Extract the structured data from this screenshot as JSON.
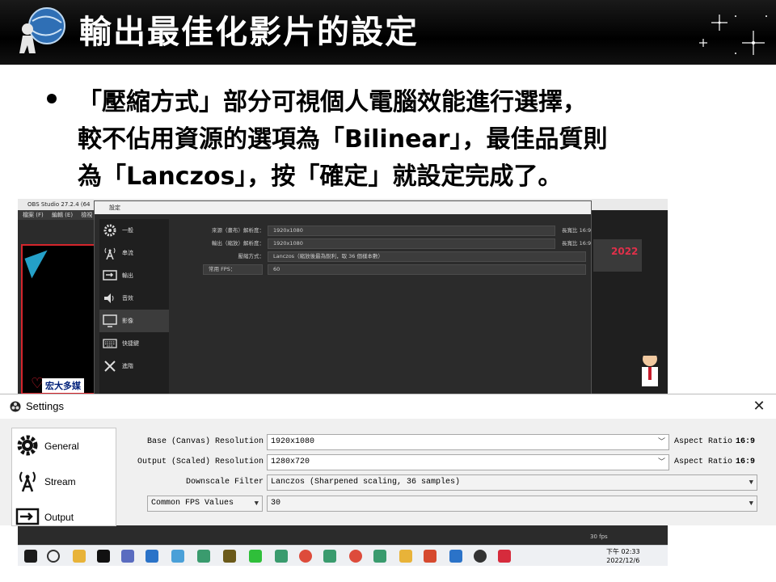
{
  "slide": {
    "title": "輸出最佳化影片的設定",
    "bullet_lines": [
      "「壓縮方式」部分可視個人電腦效能進行選擇，",
      "較不佔用資源的選項為「Bilinear」，最佳品質則",
      "為「Lanczos」，按「確定」就設定完成了。"
    ]
  },
  "obs_window": {
    "title": "OBS Studio 27.2.4 (64",
    "menu": [
      "檔案 (F)",
      "編輯 (E)",
      "檢視"
    ],
    "banner_text": "宏大多媒",
    "year_text": "2022",
    "fps_text": "30 fps",
    "dark_settings": {
      "title": "設定",
      "sidebar": [
        {
          "label": "一般",
          "icon": "gear-icon"
        },
        {
          "label": "串流",
          "icon": "antenna-icon"
        },
        {
          "label": "輸出",
          "icon": "output-icon"
        },
        {
          "label": "音效",
          "icon": "speaker-icon"
        },
        {
          "label": "影像",
          "icon": "monitor-icon",
          "selected": true
        },
        {
          "label": "快捷鍵",
          "icon": "keyboard-icon"
        },
        {
          "label": "進階",
          "icon": "tools-icon"
        }
      ],
      "rows": [
        {
          "label": "來源（畫布）解析度：",
          "value": "1920x1080",
          "ratio_label": "長寬比",
          "ratio_value": "16:9"
        },
        {
          "label": "輸出（縮放）解析度：",
          "value": "1920x1080",
          "ratio_label": "長寬比",
          "ratio_value": "16:9"
        },
        {
          "label": "壓縮方式：",
          "value": "Lanczos（縮放後最為銳利，取 36 個樣本數）"
        },
        {
          "label": "常用 FPS：",
          "value": "60"
        }
      ]
    },
    "clock": {
      "time": "下午 02:33",
      "date": "2022/12/6"
    }
  },
  "light_settings": {
    "title": "Settings",
    "close_glyph": "✕",
    "sidebar": [
      {
        "label": "General",
        "icon": "gear-icon"
      },
      {
        "label": "Stream",
        "icon": "antenna-icon"
      },
      {
        "label": "Output",
        "icon": "output-icon"
      }
    ],
    "rows": {
      "base_label": "Base (Canvas) Resolution",
      "base_value": "1920x1080",
      "output_label": "Output (Scaled) Resolution",
      "output_value": "1280x720",
      "filter_label": "Downscale Filter",
      "filter_value": "Lanczos (Sharpened scaling, 36 samples)",
      "fps_type": "Common FPS Values",
      "fps_value": "30",
      "ratio_label": "Aspect Ratio",
      "ratio_value": "16:9"
    }
  },
  "colors": {
    "header_bg": "#000000",
    "obs_dark": "#2b2b2b",
    "accent_red": "#d4252c",
    "accent_blue": "#24a0c8"
  }
}
